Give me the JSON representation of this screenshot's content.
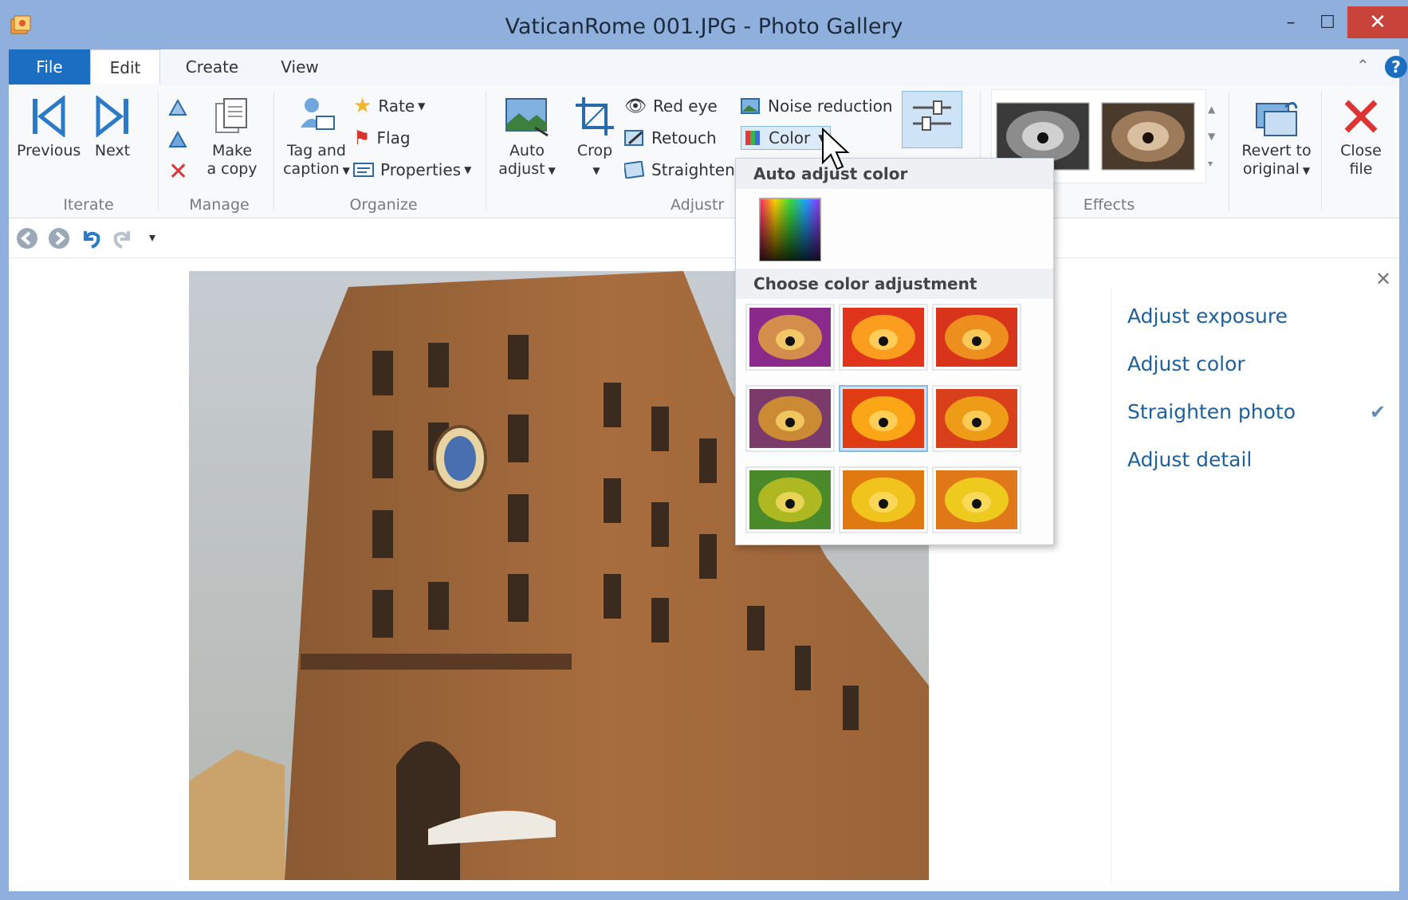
{
  "window": {
    "title": "VaticanRome 001.JPG - Photo Gallery"
  },
  "tabs": [
    {
      "label": "File"
    },
    {
      "label": "Edit"
    },
    {
      "label": "Create"
    },
    {
      "label": "View"
    }
  ],
  "ribbon": {
    "iterate": {
      "label": "Iterate",
      "previous": "Previous",
      "next": "Next"
    },
    "manage": {
      "label": "Manage",
      "make_copy_1": "Make",
      "make_copy_2": "a copy"
    },
    "organize": {
      "label": "Organize",
      "tag_caption_1": "Tag and",
      "tag_caption_2": "caption",
      "rate": "Rate",
      "flag": "Flag",
      "properties": "Properties"
    },
    "adjustments": {
      "label": "Adjustr",
      "auto_adjust_1": "Auto",
      "auto_adjust_2": "adjust",
      "crop": "Crop",
      "red_eye": "Red eye",
      "retouch": "Retouch",
      "straighten": "Straighten",
      "noise_reduction": "Noise reduction",
      "color": "Color",
      "fine_tune": "Fine"
    },
    "effects": {
      "label": "Effects"
    },
    "revert": {
      "line1": "Revert to",
      "line2": "original"
    },
    "close": {
      "line1": "Close",
      "line2": "file"
    }
  },
  "color_dropdown": {
    "auto_header": "Auto adjust color",
    "choose_header": "Choose color adjustment",
    "selected_index": 4
  },
  "right_pane": {
    "items": [
      {
        "label": "Adjust exposure"
      },
      {
        "label": "Adjust color"
      },
      {
        "label": "Straighten photo",
        "checked": true
      },
      {
        "label": "Adjust detail"
      }
    ]
  },
  "colors": {
    "title_bar": "#8fb0dc",
    "file_tab": "#1b6ec2",
    "close_button": "#c8433a",
    "link": "#1e5f9e"
  }
}
